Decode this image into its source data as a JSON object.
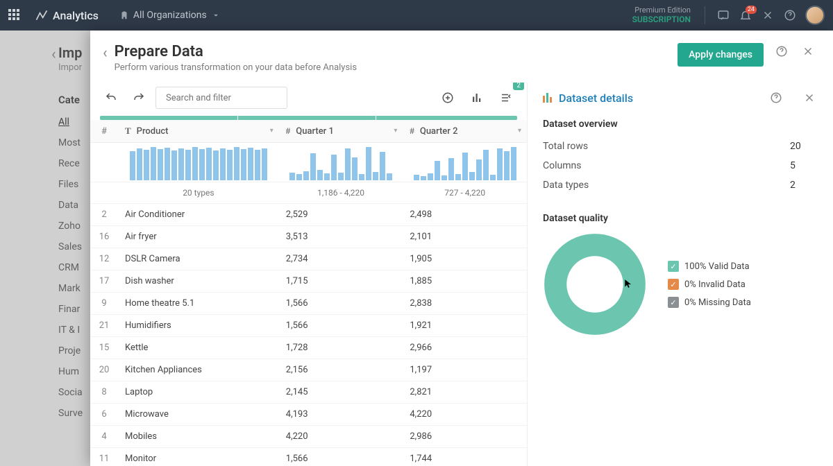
{
  "navbar": {
    "brand": "Analytics",
    "org_label": "All Organizations",
    "premium_line1": "Premium Edition",
    "premium_line2": "SUBSCRIPTION",
    "notif_count": "24"
  },
  "backdrop": {
    "title": "Imp",
    "crumb": "Impor",
    "cat_heading": "Cate",
    "items": [
      "All",
      "Most",
      "Rece",
      "Files",
      "Data",
      "Zoho",
      "Sales",
      "CRM",
      "Mark",
      "Finar",
      "IT & I",
      "Proje",
      "Hum",
      "Socia",
      "Surve"
    ]
  },
  "modal": {
    "title": "Prepare Data",
    "subtitle": "Perform various transformation on your data before Analysis",
    "apply_label": "Apply changes",
    "search_placeholder": "Search and filter",
    "badge_count": "2"
  },
  "columns": [
    {
      "type": "#",
      "label": "#"
    },
    {
      "type": "T",
      "label": "Product",
      "summary": "20 types"
    },
    {
      "type": "#",
      "label": "Quarter 1",
      "summary": "1,186 - 4,220"
    },
    {
      "type": "#",
      "label": "Quarter 2",
      "summary": "727 - 4,220"
    }
  ],
  "rows": [
    {
      "i": "2",
      "p": "Air Conditioner",
      "q1": "2,529",
      "q2": "2,498"
    },
    {
      "i": "16",
      "p": "Air fryer",
      "q1": "3,513",
      "q2": "2,101"
    },
    {
      "i": "12",
      "p": "DSLR Camera",
      "q1": "2,734",
      "q2": "1,905"
    },
    {
      "i": "17",
      "p": "Dish washer",
      "q1": "1,715",
      "q2": "1,885"
    },
    {
      "i": "9",
      "p": "Home theatre 5.1",
      "q1": "1,566",
      "q2": "2,838"
    },
    {
      "i": "21",
      "p": "Humidifiers",
      "q1": "1,566",
      "q2": "1,921"
    },
    {
      "i": "15",
      "p": "Kettle",
      "q1": "1,728",
      "q2": "2,966"
    },
    {
      "i": "20",
      "p": "Kitchen Appliances",
      "q1": "2,156",
      "q2": "1,197"
    },
    {
      "i": "8",
      "p": "Laptop",
      "q1": "2,145",
      "q2": "2,821"
    },
    {
      "i": "6",
      "p": "Microwave",
      "q1": "4,193",
      "q2": "4,220"
    },
    {
      "i": "4",
      "p": "Mobiles",
      "q1": "4,220",
      "q2": "2,986"
    },
    {
      "i": "11",
      "p": "Monitor",
      "q1": "1,566",
      "q2": "1,744"
    }
  ],
  "side": {
    "title": "Dataset details",
    "overview_heading": "Dataset overview",
    "kv": [
      {
        "k": "Total rows",
        "v": "20"
      },
      {
        "k": "Columns",
        "v": "5"
      },
      {
        "k": "Data types",
        "v": "2"
      }
    ],
    "quality_heading": "Dataset quality",
    "legend": [
      {
        "color": "#6cc6af",
        "label": "100% Valid Data",
        "check": true
      },
      {
        "color": "#e58b4a",
        "label": "0% Invalid Data",
        "check": true
      },
      {
        "color": "#8a8f94",
        "label": "0% Missing Data",
        "check": true
      }
    ]
  },
  "chart_data": {
    "type": "pie",
    "title": "Dataset quality",
    "series": [
      {
        "name": "Valid Data",
        "value": 100,
        "color": "#6cc6af"
      },
      {
        "name": "Invalid Data",
        "value": 0,
        "color": "#e58b4a"
      },
      {
        "name": "Missing Data",
        "value": 0,
        "color": "#8a8f94"
      }
    ]
  },
  "sparklines": {
    "product": [
      42,
      46,
      44,
      48,
      45,
      47,
      43,
      46,
      44,
      48,
      45,
      47,
      43,
      46,
      44,
      48,
      45,
      47,
      44,
      46
    ],
    "q1": [
      10,
      8,
      12,
      36,
      14,
      9,
      34,
      10,
      42,
      30,
      8,
      44,
      11,
      38,
      9
    ],
    "q2": [
      8,
      6,
      10,
      28,
      7,
      32,
      9,
      40,
      12,
      30,
      44,
      8,
      46,
      42,
      48
    ]
  }
}
